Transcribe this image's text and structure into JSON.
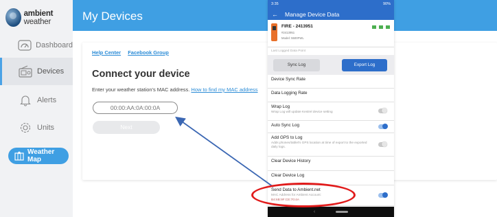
{
  "sidebar": {
    "logo_bold": "ambient",
    "logo_light": "weather",
    "items": [
      {
        "label": "Dashboard",
        "icon": "gauge-icon"
      },
      {
        "label": "Devices",
        "icon": "radio-device-icon"
      },
      {
        "label": "Alerts",
        "icon": "bell-icon"
      },
      {
        "label": "Units",
        "icon": "gear-icon"
      }
    ],
    "weather_map_label": "Weather Map"
  },
  "header": {
    "title": "My Devices"
  },
  "card": {
    "help_center": "Help Center",
    "facebook_group": "Facebook Group",
    "title": "Connect your device",
    "subtitle": "Enter your weather station's MAC address.",
    "find_mac_link": "How to find my MAC address",
    "mac_placeholder": "00:00:AA:0A:00:0A",
    "next_label": "Next"
  },
  "phone": {
    "status_time": "3:35",
    "status_right": "90%",
    "title": "Manage Device Data",
    "device_name": "FIRE - 2413951",
    "device_id": "#2413951",
    "device_model": "Model: 5500FWL",
    "last_logged": "Last Logged Data Point",
    "sync_log": "Sync Log",
    "export_log": "Export Log",
    "rows": [
      {
        "label": "Device Sync Rate",
        "desc": "",
        "toggle": null
      },
      {
        "label": "Data Logging Rate",
        "desc": "",
        "toggle": null
      },
      {
        "label": "Wrap Log",
        "desc": "Wrap Log will update Kestrel device setting",
        "toggle": "off"
      },
      {
        "label": "Auto Sync Log",
        "desc": "",
        "toggle": "on"
      },
      {
        "label": "Add GPS to Log",
        "desc": "Adds phones/tablet's GPS location at time of export to the exported daily logs.",
        "toggle": "off"
      },
      {
        "label": "Clear Device History",
        "desc": "",
        "toggle": null
      },
      {
        "label": "Clear Device Log",
        "desc": "",
        "toggle": null
      },
      {
        "label": "Send Data to Ambient.net",
        "desc": "MAC Address for Ambient Account:",
        "desc2": "B4:6B:9F:CE:70:4A",
        "toggle": "on"
      }
    ]
  },
  "colors": {
    "brand_blue": "#3f9fe3",
    "phone_blue": "#2d6eca",
    "highlight_red": "#e11b1b"
  }
}
